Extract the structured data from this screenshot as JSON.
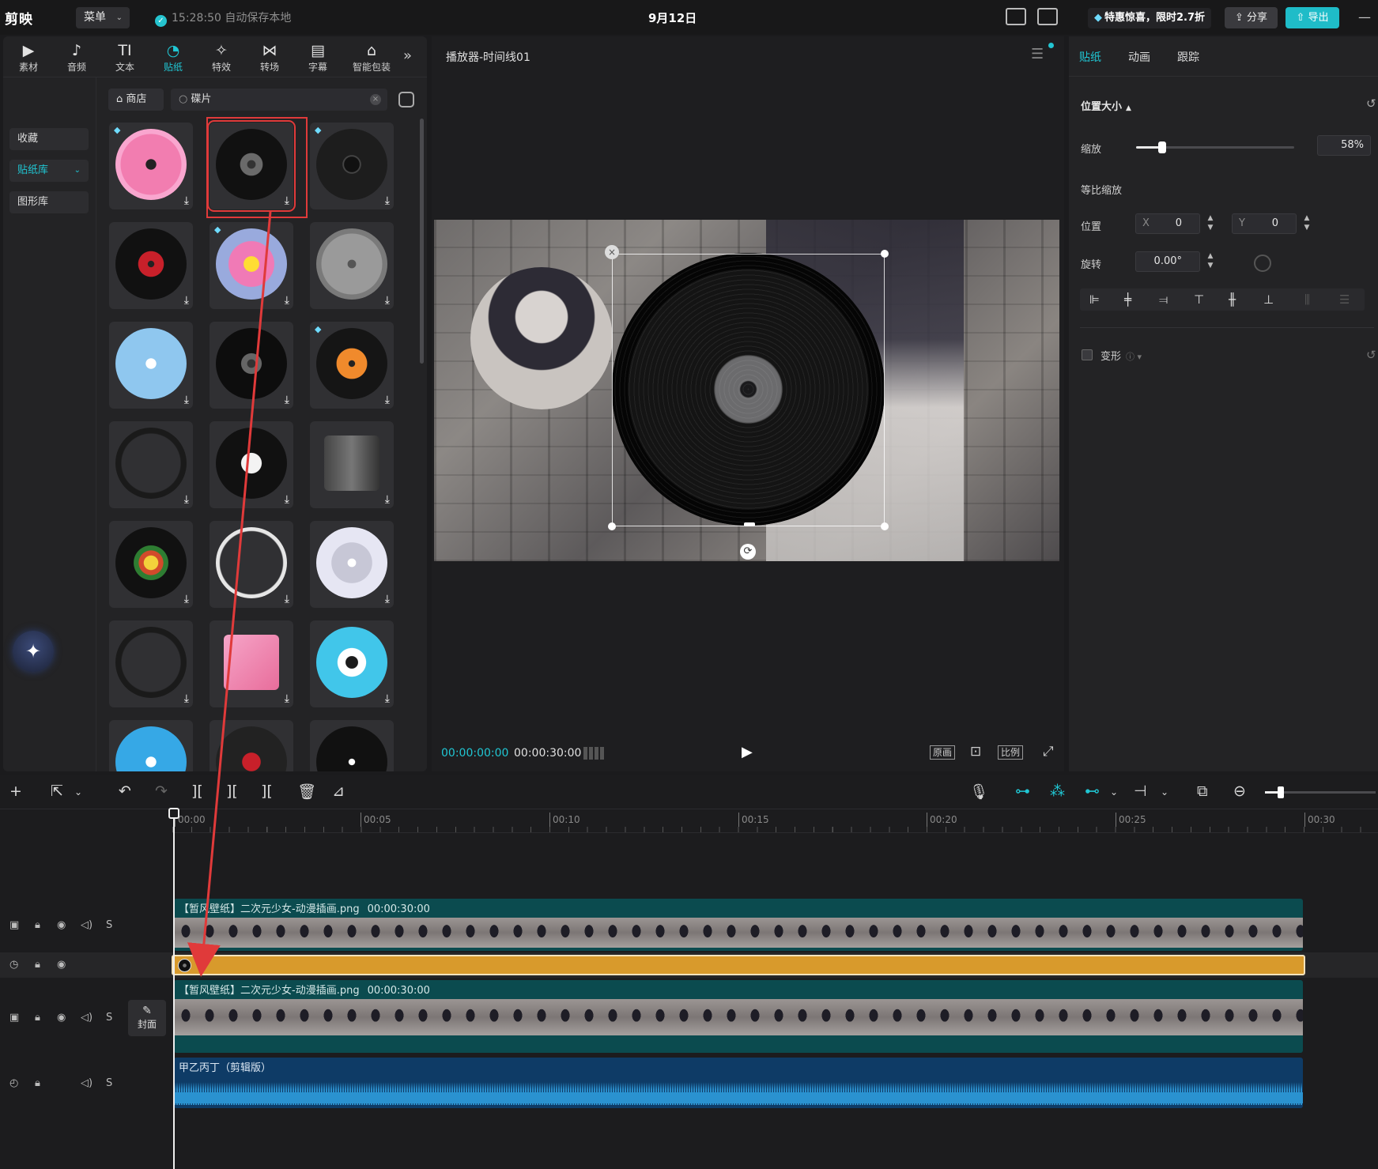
{
  "app": {
    "logo": "剪映",
    "menu_label": "菜单",
    "autosave": "15:28:50 自动保存本地",
    "title": "9月12日"
  },
  "topbar": {
    "promo": "特惠惊喜，限时2.7折",
    "share": "分享",
    "export": "导出"
  },
  "media_tabs": [
    {
      "label": "素材",
      "icon": "▶"
    },
    {
      "label": "音频",
      "icon": "♪"
    },
    {
      "label": "文本",
      "icon": "TI"
    },
    {
      "label": "贴纸",
      "icon": "◔"
    },
    {
      "label": "特效",
      "icon": "✧"
    },
    {
      "label": "转场",
      "icon": "⋈"
    },
    {
      "label": "字幕",
      "icon": "▤"
    },
    {
      "label": "智能包装",
      "icon": "⌂"
    }
  ],
  "sidebar": {
    "items": [
      "收藏",
      "贴纸库",
      "图形库"
    ]
  },
  "library": {
    "store_label": "商店",
    "search_value": "碟片"
  },
  "stickers": [
    {
      "name": "sticker-pink-love-record",
      "vip": true
    },
    {
      "name": "sticker-black-vinyl",
      "vip": false,
      "selected": true
    },
    {
      "name": "sticker-music-radio",
      "vip": true
    },
    {
      "name": "sticker-red-label-vinyl",
      "vip": false
    },
    {
      "name": "sticker-cartoon-cd",
      "vip": true
    },
    {
      "name": "sticker-grey-cd",
      "vip": false
    },
    {
      "name": "sticker-sky-cd",
      "vip": false
    },
    {
      "name": "sticker-black-vinyl-2",
      "vip": false
    },
    {
      "name": "sticker-orange-vinyl",
      "vip": true
    },
    {
      "name": "sticker-dark-ring",
      "vip": false
    },
    {
      "name": "sticker-small-vinyl",
      "vip": false
    },
    {
      "name": "sticker-turntable",
      "vip": false
    },
    {
      "name": "sticker-rasta-vinyl",
      "vip": false
    },
    {
      "name": "sticker-white-ring",
      "vip": false
    },
    {
      "name": "sticker-silver-cd",
      "vip": false
    },
    {
      "name": "sticker-dark-ring-2",
      "vip": false
    },
    {
      "name": "sticker-pink-album",
      "vip": false
    },
    {
      "name": "sticker-blue-cd",
      "vip": false
    },
    {
      "name": "sticker-blue-disc",
      "vip": false
    },
    {
      "name": "sticker-record-player",
      "vip": false
    },
    {
      "name": "sticker-heart-vinyl",
      "vip": false
    }
  ],
  "player": {
    "title": "播放器-时间线01",
    "current_time": "00:00:00:00",
    "duration": "00:00:30:00",
    "btn_original": "原画",
    "btn_ratio": "比例"
  },
  "props": {
    "tabs": [
      "贴纸",
      "动画",
      "跟踪"
    ],
    "section_title": "位置大小",
    "scale_label": "缩放",
    "scale_value": "58%",
    "scale_fraction": 0.58,
    "uniform_label": "等比缩放",
    "position_label": "位置",
    "x_label": "X",
    "x_value": "0",
    "y_label": "Y",
    "y_value": "0",
    "rotate_label": "旋转",
    "rotate_value": "0.00°",
    "deform_label": "变形"
  },
  "timeline": {
    "ticks": [
      "00:00",
      "00:05",
      "00:10",
      "00:15",
      "00:20",
      "00:25",
      "00:30"
    ],
    "track1_name": "【暂风壁纸】二次元少女-动漫插画.png",
    "track1_duration": "00:00:30:00",
    "track3_name": "【暂风壁纸】二次元少女-动漫插画.png",
    "track3_duration": "00:00:30:00",
    "audio_name": "甲乙丙丁（剪辑版）",
    "cover_label": "封面",
    "solo_label": "S"
  },
  "colors": {
    "accent": "#20c6d3",
    "sticker_clip": "#d89a2c",
    "annotation": "#e03a3a"
  }
}
